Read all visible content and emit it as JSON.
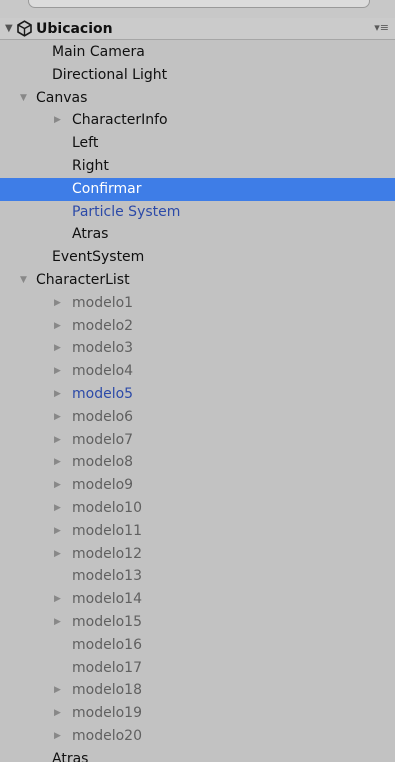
{
  "hierarchy": {
    "scene": {
      "name": "Ubicacion",
      "expand_glyph": "▼",
      "icon": "unity-scene-icon",
      "menu_glyph": "▾≡"
    },
    "rows": [
      {
        "label": "Main Camera",
        "depth": 1,
        "expander": "",
        "state": "normal"
      },
      {
        "label": "Directional Light",
        "depth": 1,
        "expander": "",
        "state": "normal"
      },
      {
        "label": "Canvas",
        "depth": 1,
        "expander": "▼",
        "state": "normal"
      },
      {
        "label": "CharacterInfo",
        "depth": 2,
        "expander": "▶",
        "state": "normal"
      },
      {
        "label": "Left",
        "depth": 2,
        "expander": "",
        "state": "normal"
      },
      {
        "label": "Right",
        "depth": 2,
        "expander": "",
        "state": "normal"
      },
      {
        "label": "Confirmar",
        "depth": 2,
        "expander": "",
        "state": "selected"
      },
      {
        "label": "Particle System",
        "depth": 2,
        "expander": "",
        "state": "blue"
      },
      {
        "label": "Atras",
        "depth": 2,
        "expander": "",
        "state": "normal"
      },
      {
        "label": "EventSystem",
        "depth": 1,
        "expander": "",
        "state": "normal"
      },
      {
        "label": "CharacterList",
        "depth": 1,
        "expander": "▼",
        "state": "normal"
      },
      {
        "label": "modelo1",
        "depth": 2,
        "expander": "▶",
        "state": "dim"
      },
      {
        "label": "modelo2",
        "depth": 2,
        "expander": "▶",
        "state": "dim"
      },
      {
        "label": "modelo3",
        "depth": 2,
        "expander": "▶",
        "state": "dim"
      },
      {
        "label": "modelo4",
        "depth": 2,
        "expander": "▶",
        "state": "dim"
      },
      {
        "label": "modelo5",
        "depth": 2,
        "expander": "▶",
        "state": "blue"
      },
      {
        "label": "modelo6",
        "depth": 2,
        "expander": "▶",
        "state": "dim"
      },
      {
        "label": "modelo7",
        "depth": 2,
        "expander": "▶",
        "state": "dim"
      },
      {
        "label": "modelo8",
        "depth": 2,
        "expander": "▶",
        "state": "dim"
      },
      {
        "label": "modelo9",
        "depth": 2,
        "expander": "▶",
        "state": "dim"
      },
      {
        "label": "modelo10",
        "depth": 2,
        "expander": "▶",
        "state": "dim"
      },
      {
        "label": "modelo11",
        "depth": 2,
        "expander": "▶",
        "state": "dim"
      },
      {
        "label": "modelo12",
        "depth": 2,
        "expander": "▶",
        "state": "dim"
      },
      {
        "label": "modelo13",
        "depth": 2,
        "expander": "",
        "state": "dim"
      },
      {
        "label": "modelo14",
        "depth": 2,
        "expander": "▶",
        "state": "dim"
      },
      {
        "label": "modelo15",
        "depth": 2,
        "expander": "▶",
        "state": "dim"
      },
      {
        "label": "modelo16",
        "depth": 2,
        "expander": "",
        "state": "dim"
      },
      {
        "label": "modelo17",
        "depth": 2,
        "expander": "",
        "state": "dim"
      },
      {
        "label": "modelo18",
        "depth": 2,
        "expander": "▶",
        "state": "dim"
      },
      {
        "label": "modelo19",
        "depth": 2,
        "expander": "▶",
        "state": "dim"
      },
      {
        "label": "modelo20",
        "depth": 2,
        "expander": "▶",
        "state": "dim"
      },
      {
        "label": "Atras",
        "depth": 1,
        "expander": "",
        "state": "normal"
      }
    ]
  },
  "colors": {
    "panel_bg": "#c2c2c2",
    "selection": "#3e7de7",
    "prefab_blue": "#2c4aa8",
    "inactive_gray": "#606060"
  }
}
